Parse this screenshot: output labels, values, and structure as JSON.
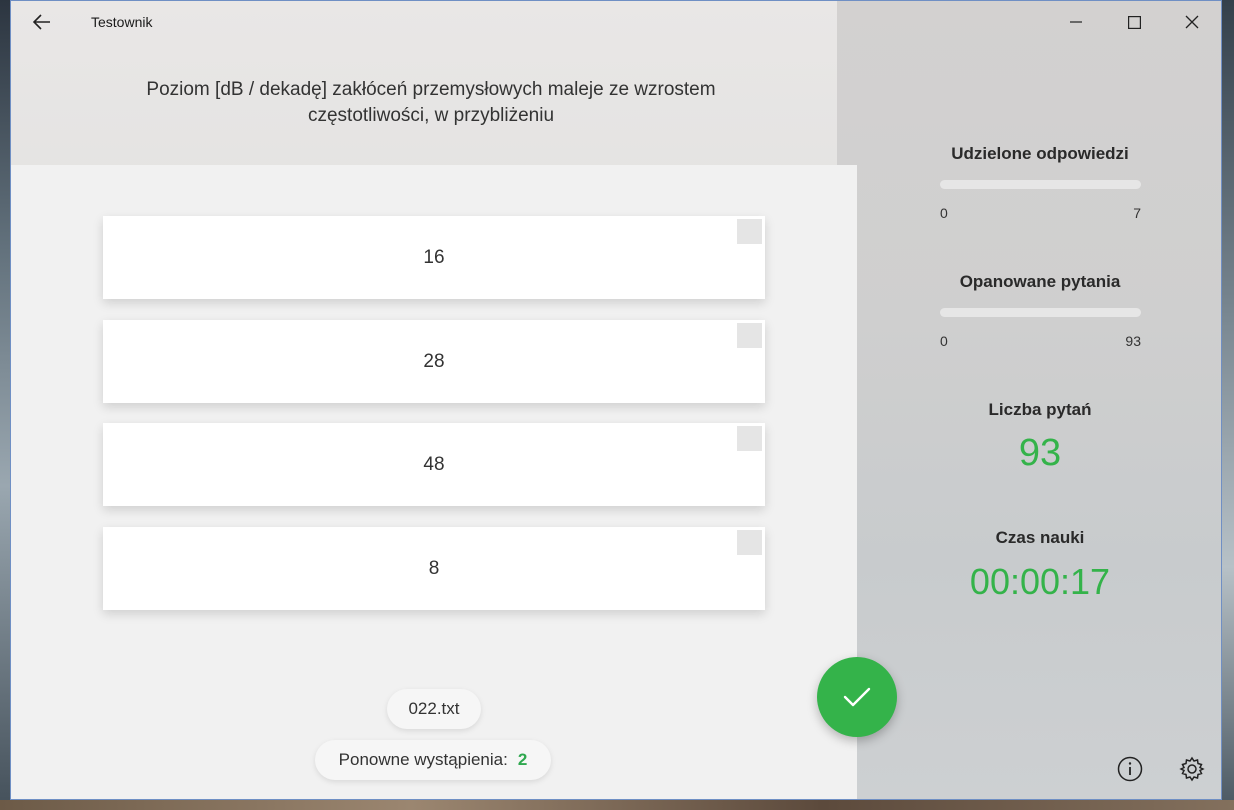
{
  "app": {
    "title": "Testownik"
  },
  "question": {
    "text": "Poziom [dB / dekadę] zakłóceń przemysłowych maleje ze wzrostem częstotliwości, w przybliżeniu"
  },
  "answers": [
    {
      "label": "16",
      "checked": false
    },
    {
      "label": "28",
      "checked": false
    },
    {
      "label": "48",
      "checked": false
    },
    {
      "label": "8",
      "checked": false
    }
  ],
  "footer": {
    "file_name": "022.txt",
    "repeat_label": "Ponowne wystąpienia:",
    "repeat_count": "2"
  },
  "stats": {
    "answered": {
      "title": "Udzielone odpowiedzi",
      "min": "0",
      "max": "7",
      "progress": 0
    },
    "mastered": {
      "title": "Opanowane pytania",
      "min": "0",
      "max": "93",
      "progress": 0
    },
    "question_count": {
      "title": "Liczba pytań",
      "value": "93"
    },
    "study_time": {
      "title": "Czas nauki",
      "value": "00:00:17"
    }
  },
  "colors": {
    "accent": "#34b34a",
    "window_border": "#6f8fc4"
  },
  "icons": {
    "back": "arrow-left-icon",
    "minimize": "minimize-icon",
    "maximize": "maximize-icon",
    "close": "close-icon",
    "confirm": "checkmark-icon",
    "info": "info-icon",
    "settings": "gear-icon"
  }
}
